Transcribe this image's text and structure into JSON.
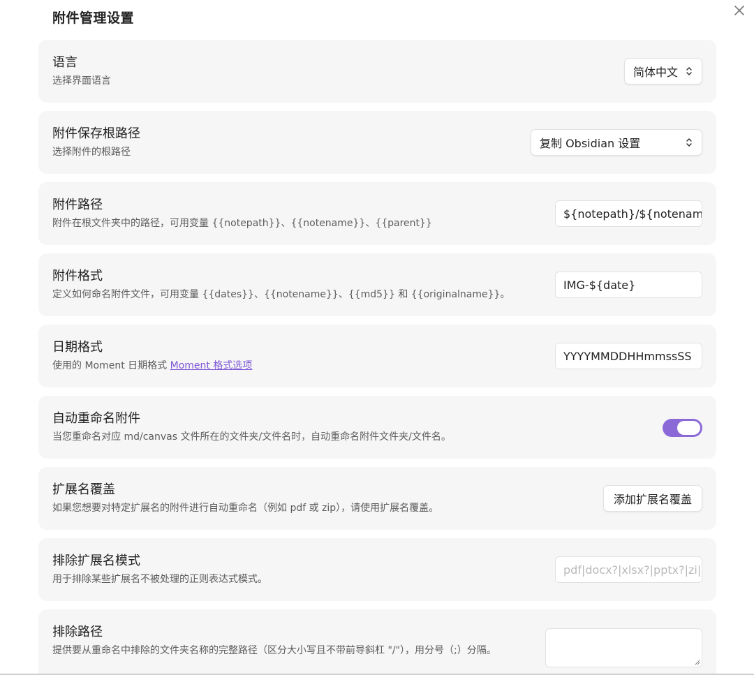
{
  "page": {
    "title": "附件管理设置"
  },
  "settings": [
    {
      "id": "language",
      "name": "语言",
      "desc": "选择界面语言",
      "control": "select",
      "value": "简体中文"
    },
    {
      "id": "root-path",
      "name": "附件保存根路径",
      "desc": "选择附件的根路径",
      "control": "select",
      "value": "复制 Obsidian 设置"
    },
    {
      "id": "attachment-path",
      "name": "附件路径",
      "desc": "附件在根文件夹中的路径，可用变量 {{notepath}}、{{notename}}、{{parent}}",
      "control": "input",
      "value": "${notepath}/${notename"
    },
    {
      "id": "attachment-format",
      "name": "附件格式",
      "desc": "定义如何命名附件文件，可用变量 {{dates}}、{{notename}}、{{md5}} 和 {{originalname}}。",
      "control": "input",
      "value": "IMG-${date}"
    },
    {
      "id": "date-format",
      "name": "日期格式",
      "desc": "使用的 Moment 日期格式",
      "link": "Moment 格式选项",
      "control": "input",
      "value": "YYYYMMDDHHmmssSS"
    },
    {
      "id": "auto-rename",
      "name": "自动重命名附件",
      "desc": "当您重命名对应 md/canvas 文件所在的文件夹/文件名时，自动重命名附件文件夹/文件名。",
      "control": "toggle",
      "value": true
    },
    {
      "id": "ext-override",
      "name": "扩展名覆盖",
      "desc": "如果您想要对特定扩展名的附件进行自动重命名（例如 pdf 或 zip），请使用扩展名覆盖。",
      "control": "button",
      "button_label": "添加扩展名覆盖"
    },
    {
      "id": "exclude-ext",
      "name": "排除扩展名模式",
      "desc": "用于排除某些扩展名不被处理的正则表达式模式。",
      "control": "input",
      "placeholder": "pdf|docx?|xlsx?|pptx?|zi|"
    },
    {
      "id": "exclude-path",
      "name": "排除路径",
      "desc": "提供要从重命名中排除的文件夹名称的完整路径（区分大小写且不带前导斜杠 \"/\"），用分号（;）分隔。",
      "control": "textarea",
      "value": ""
    }
  ],
  "colors": {
    "accent": "#8b6ad8",
    "link": "#7b55d6",
    "row_bg": "#f6f6f6"
  },
  "icons": {
    "close": "close-icon",
    "select_chevron": "chevron-updown-icon",
    "resize": "resize-grip-icon"
  }
}
